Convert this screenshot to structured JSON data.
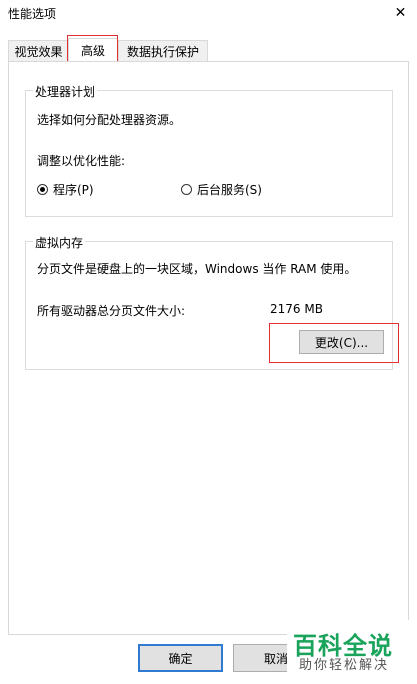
{
  "window": {
    "title": "性能选项",
    "close_symbol": "✕"
  },
  "tabs": [
    {
      "label": "视觉效果"
    },
    {
      "label": "高级"
    },
    {
      "label": "数据执行保护"
    }
  ],
  "processor_group": {
    "legend": "处理器计划",
    "description": "选择如何分配处理器资源。",
    "adjust_label": "调整以优化性能:",
    "options": [
      {
        "label": "程序(P)",
        "selected": true
      },
      {
        "label": "后台服务(S)",
        "selected": false
      }
    ]
  },
  "memory_group": {
    "legend": "虚拟内存",
    "description": "分页文件是硬盘上的一块区域，Windows 当作 RAM 使用。",
    "total_label": "所有驱动器总分页文件大小:",
    "total_value": "2176 MB",
    "change_button": "更改(C)..."
  },
  "footer": {
    "ok": "确定",
    "cancel": "取消"
  },
  "watermark": {
    "title": "百科全说",
    "subtitle": "助你轻松解决",
    "color": "#1aa35b"
  },
  "highlight_color": "#e0302f"
}
